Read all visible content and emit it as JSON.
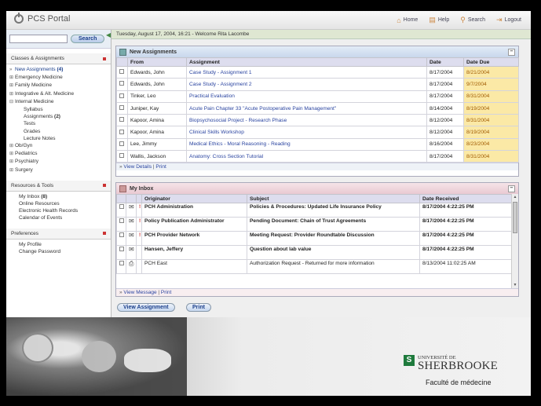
{
  "app": {
    "title": "PCS Portal",
    "nav": [
      {
        "icon": "home-icon",
        "label": "Home"
      },
      {
        "icon": "help-icon",
        "label": "Help"
      },
      {
        "icon": "search-icon",
        "label": "Search"
      },
      {
        "icon": "logout-icon",
        "label": "Logout"
      }
    ],
    "date_line": "Tuesday, August 17, 2004, 16:21 - Welcome Rita Lacombe"
  },
  "sidebar": {
    "search_label": "Search",
    "sections": [
      {
        "title": "Classes & Assignments",
        "items": [
          {
            "label": "New Assignments",
            "count": "(4)",
            "level": 0,
            "active": true
          },
          {
            "label": "Emergency Medicine",
            "level": 0,
            "expand": "+"
          },
          {
            "label": "Family Medicine",
            "level": 0,
            "expand": "+"
          },
          {
            "label": "Integrative & Alt. Medicine",
            "level": 0,
            "expand": "+"
          },
          {
            "label": "Internal Medicine",
            "level": 0,
            "expand": "−"
          },
          {
            "label": "Syllabus",
            "level": 1
          },
          {
            "label": "Assignments",
            "count": "(2)",
            "level": 1
          },
          {
            "label": "Tests",
            "level": 1
          },
          {
            "label": "Grades",
            "level": 1
          },
          {
            "label": "Lecture Notes",
            "level": 1
          },
          {
            "label": "Ob/Gyn",
            "level": 0,
            "expand": "+"
          },
          {
            "label": "Pediatrics",
            "level": 0,
            "expand": "+"
          },
          {
            "label": "Psychiatry",
            "level": 0,
            "expand": "+"
          },
          {
            "label": "Surgery",
            "level": 0,
            "expand": "+"
          }
        ]
      },
      {
        "title": "Resources & Tools",
        "items": [
          {
            "label": "My Inbox",
            "count": "(8)",
            "level": 2
          },
          {
            "label": "Online Resources",
            "level": 2
          },
          {
            "label": "Electronic Health Records",
            "level": 2
          },
          {
            "label": "Calendar of Events",
            "level": 2
          }
        ]
      },
      {
        "title": "Preferences",
        "items": [
          {
            "label": "My Profile",
            "level": 2
          },
          {
            "label": "Change Password",
            "level": 2
          }
        ]
      }
    ]
  },
  "assignments": {
    "title": "New Assignments",
    "columns": [
      "From",
      "Assignment",
      "Date",
      "Date Due"
    ],
    "rows": [
      [
        "Edwards, John",
        "Case Study - Assignment 1",
        "8/17/2004",
        "8/21/2004"
      ],
      [
        "Edwards, John",
        "Case Study - Assignment 2",
        "8/17/2004",
        "9/7/2004"
      ],
      [
        "Tinker, Leo",
        "Practical Evaluation",
        "8/17/2004",
        "8/31/2004"
      ],
      [
        "Juniper, Kay",
        "Acute Pain Chapter 33 \"Acute Postoperative Pain Management\"",
        "8/14/2004",
        "8/19/2004"
      ],
      [
        "Kapoor, Amina",
        "Biopsychosocial Project - Research Phase",
        "8/12/2004",
        "8/31/2004"
      ],
      [
        "Kapoor, Amina",
        "Clinical Skills Workshop",
        "8/12/2004",
        "8/19/2004"
      ],
      [
        "Lee, Jimmy",
        "Medical Ethics - Moral Reasoning - Reading",
        "8/16/2004",
        "8/23/2004"
      ],
      [
        "Wallis, Jackson",
        "Anatomy: Cross Section Tutorial",
        "8/17/2004",
        "8/31/2004"
      ]
    ],
    "footer_view": "View Details",
    "footer_print": "Print"
  },
  "inbox": {
    "title": "My Inbox",
    "columns": [
      "Originator",
      "Subject",
      "Date Received"
    ],
    "rows": [
      {
        "from": "PCH Administration",
        "subject": "Policies & Procedures: Updated Life Insurance Policy",
        "date": "8/17/2004  4:22:25 PM",
        "unread": true,
        "urgent": true
      },
      {
        "from": "Policy Publication Administrator",
        "subject": "Pending Document: Chain of Trust Agreements",
        "date": "8/17/2004  4:22:25 PM",
        "unread": true,
        "urgent": true
      },
      {
        "from": "PCH Provider Network",
        "subject": "Meeting Request: Provider Roundtable Discussion",
        "date": "8/17/2004  4:22:25 PM",
        "unread": true,
        "urgent": true
      },
      {
        "from": "Hansen, Jeffery",
        "subject": "Question about lab value",
        "date": "8/17/2004  4:22:25 PM",
        "unread": true,
        "urgent": false
      },
      {
        "from": "PCH East",
        "subject": "Authorization Request - Returned for more information",
        "date": "8/13/2004  11:02:25 AM",
        "unread": false,
        "urgent": false
      }
    ],
    "footer_view": "View Message",
    "footer_print": "Print"
  },
  "actions": {
    "view_assignment": "View Assignment",
    "print": "Print"
  },
  "branding": {
    "mark": "S",
    "univ_line1": "UNIVERSITÉ DE",
    "univ_line2": "SHERBROOKE",
    "faculty": "Faculté de médecine"
  }
}
